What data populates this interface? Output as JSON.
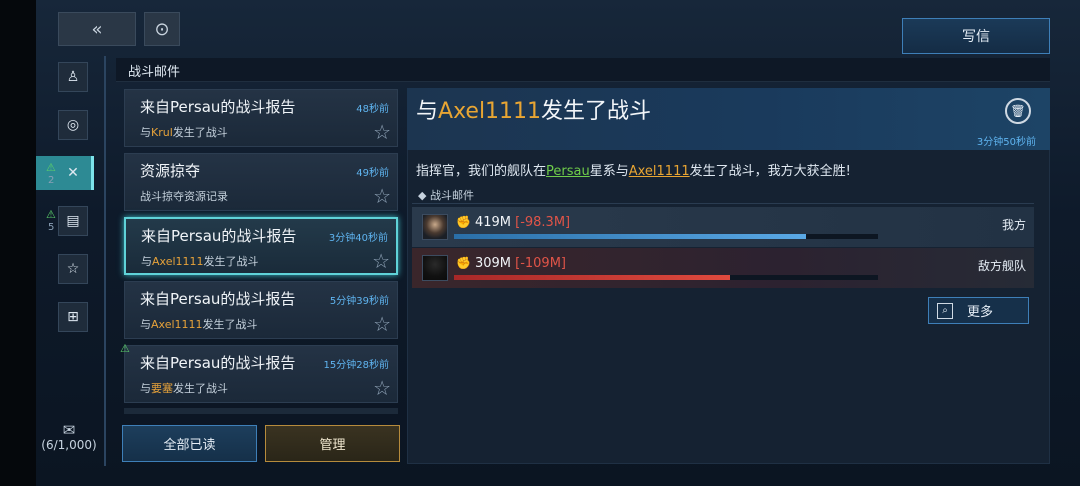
{
  "top": {
    "back_icon": "double-chevron-left",
    "refresh_icon": "circle-refresh",
    "write_label": "写信"
  },
  "section_title": "战斗邮件",
  "sidebar": {
    "items": [
      {
        "icon": "person-icon"
      },
      {
        "icon": "globe-icon"
      },
      {
        "icon": "battle-icon",
        "active": true,
        "badge": "2"
      },
      {
        "icon": "document-icon",
        "badge": "5"
      },
      {
        "icon": "star-icon"
      },
      {
        "icon": "gift-icon"
      }
    ],
    "mailbox_count": "(6/1,000)"
  },
  "mail_list": [
    {
      "title": "来自Persau的战斗报告",
      "time": "48秒前",
      "sub_prefix": "与",
      "sub_hl": "Krul",
      "sub_suffix": "发生了战斗"
    },
    {
      "title": "资源掠夺",
      "time": "49秒前",
      "sub_prefix": "战斗掠夺资源记录",
      "sub_hl": "",
      "sub_suffix": ""
    },
    {
      "title": "来自Persau的战斗报告",
      "time": "3分钟40秒前",
      "sub_prefix": "与",
      "sub_hl": "Axel1111",
      "sub_suffix": "发生了战斗"
    },
    {
      "title": "来自Persau的战斗报告",
      "time": "5分钟39秒前",
      "sub_prefix": "与",
      "sub_hl": "Axel1111",
      "sub_suffix": "发生了战斗"
    },
    {
      "title": "来自Persau的战斗报告",
      "time": "15分钟28秒前",
      "sub_prefix": "与",
      "sub_hl": "要塞",
      "sub_suffix": "发生了战斗"
    }
  ],
  "buttons": {
    "mark_all_read": "全部已读",
    "manage": "管理",
    "more": "更多"
  },
  "detail": {
    "title_prefix": "与",
    "title_hl": "Axel1111",
    "title_suffix": "发生了战斗",
    "time": "3分钟50秒前",
    "msg_a": "指挥官，我们的舰队在",
    "msg_link1": "Persau",
    "msg_b": "星系与",
    "msg_link2": "Axel1111",
    "msg_c": "发生了战斗，我方大获全胜!",
    "sub_header": "◆  战斗邮件",
    "me": {
      "power": "419M",
      "loss": "[-98.3M]",
      "label": "我方",
      "bar_fill": 0.83
    },
    "enemy": {
      "power": "309M",
      "loss": "[-109M]",
      "label": "敌方舰队",
      "bar_fill": 0.65,
      "bar_extent": 1.0
    }
  }
}
